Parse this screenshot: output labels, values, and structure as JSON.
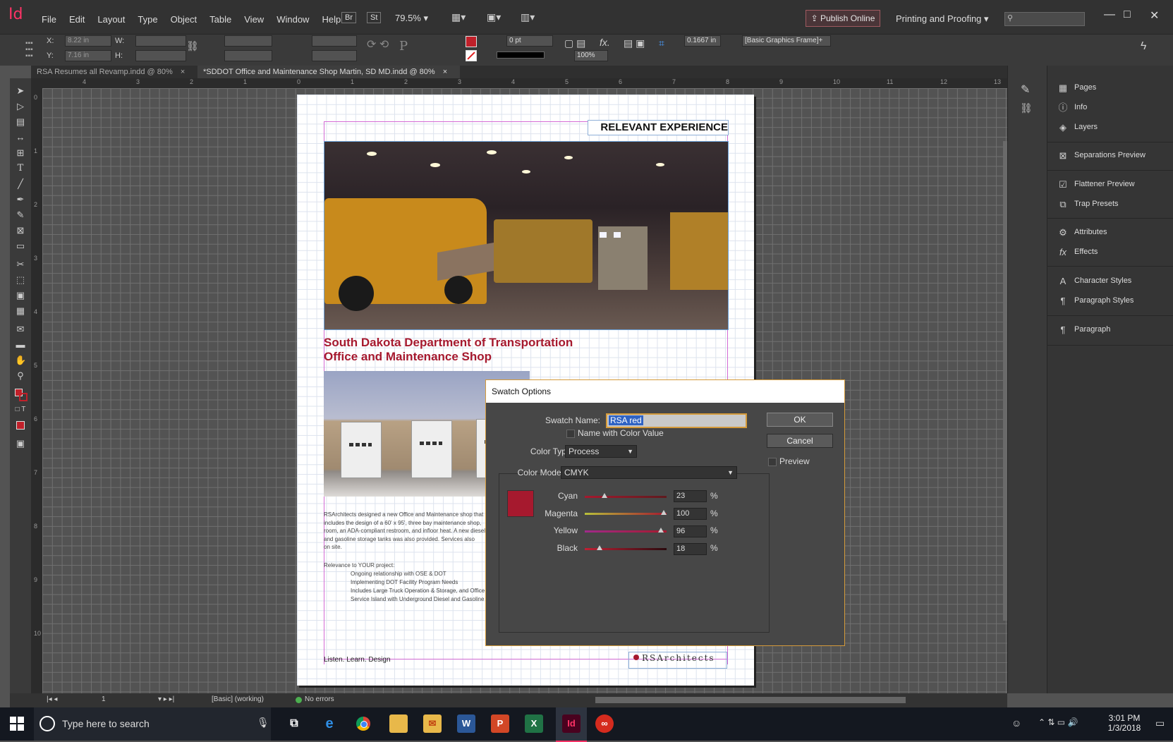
{
  "app": {
    "logo": "Id"
  },
  "menu": [
    "File",
    "Edit",
    "Layout",
    "Type",
    "Object",
    "Table",
    "View",
    "Window",
    "Help"
  ],
  "top_toolbar": {
    "br": "Br",
    "st": "St",
    "zoom": "79.5%",
    "publish_label": "Publish Online",
    "workspace": "Printing and Proofing"
  },
  "window_controls": {
    "minimize": "—",
    "maximize": "□",
    "close": "✕"
  },
  "control_bar": {
    "x_label": "X:",
    "x_value": "8.22 in",
    "y_label": "Y:",
    "y_value": "7.16 in",
    "w_label": "W:",
    "h_label": "H:",
    "stroke_weight": "0 pt",
    "opacity": "100%",
    "offset": "0.1667 in",
    "object_style": "[Basic Graphics Frame]+"
  },
  "tabs": [
    {
      "label": "RSA Resumes all Revamp.indd @ 80%",
      "close": "×"
    },
    {
      "label": "*SDDOT Office and Maintenance Shop Martin, SD MD.indd @ 80%",
      "close": "×"
    }
  ],
  "ruler_h": [
    "4",
    "3",
    "2",
    "1",
    "0",
    "1",
    "2",
    "3",
    "4",
    "5",
    "6",
    "7",
    "8",
    "9",
    "10",
    "11",
    "12",
    "13"
  ],
  "ruler_v": [
    "0",
    "1",
    "2",
    "3",
    "4",
    "5",
    "6",
    "7",
    "8",
    "9",
    "10"
  ],
  "document": {
    "heading": "RELEVANT EXPERIENCE",
    "project_title_1": "South Dakota Department of Transportation",
    "project_title_2": "Office and Maintenance Shop",
    "body_1": "RSArchitects designed a new Office and Maintenance shop that",
    "body_2": "includes the design of a 60' x 95', three bay maintenance shop,",
    "body_3": "room, an ADA-compliant restroom, and infloor heat.  A new diesel",
    "body_4": "and gasoline storage tanks was also provided. Services also",
    "body_5": "on site.",
    "relevance_title": "Relevance to YOUR project:",
    "relevance_items": [
      "Ongoing relationship with OSE & DOT",
      "Implementing DOT Facility Program Needs",
      "Includes Large Truck Operation & Storage, and Office",
      "Service Island with Underground Diesel and Gasoline"
    ],
    "footer_tagline": "Listen. Learn. Design",
    "footer_logo": "RSArchitects"
  },
  "panels": [
    {
      "label": "Pages",
      "icon": "pages-icon"
    },
    {
      "label": "Info",
      "icon": "info-icon"
    },
    {
      "label": "Layers",
      "icon": "layers-icon"
    },
    {
      "label": "Separations Preview",
      "icon": "separations-icon"
    },
    {
      "label": "Flattener Preview",
      "icon": "flattener-icon"
    },
    {
      "label": "Trap Presets",
      "icon": "trap-icon"
    },
    {
      "label": "Attributes",
      "icon": "attributes-icon"
    },
    {
      "label": "Effects",
      "icon": "effects-icon"
    },
    {
      "label": "Character Styles",
      "icon": "character-styles-icon"
    },
    {
      "label": "Paragraph Styles",
      "icon": "paragraph-styles-icon"
    },
    {
      "label": "Paragraph",
      "icon": "paragraph-icon"
    }
  ],
  "status_bar": {
    "page": "1",
    "profile": "[Basic] (working)",
    "preflight": "No errors"
  },
  "dialog": {
    "title": "Swatch Options",
    "swatch_name_label": "Swatch Name:",
    "swatch_name_value": "RSA red",
    "name_with_color_value_label": "Name with Color Value",
    "color_type_label": "Color Type:",
    "color_type_value": "Process",
    "color_mode_label": "Color Mode:",
    "color_mode_value": "CMYK",
    "ok_label": "OK",
    "cancel_label": "Cancel",
    "preview_label": "Preview",
    "swatch_color": "#a6192e",
    "channels": [
      {
        "name": "Cyan",
        "value": "23",
        "unit": "%"
      },
      {
        "name": "Magenta",
        "value": "100",
        "unit": "%"
      },
      {
        "name": "Yellow",
        "value": "96",
        "unit": "%"
      },
      {
        "name": "Black",
        "value": "18",
        "unit": "%"
      }
    ]
  },
  "taskbar": {
    "search_placeholder": "Type here to search",
    "time": "3:01 PM",
    "date": "1/3/2018"
  },
  "colors": {
    "accent": "#ff3366",
    "doc_red": "#a6192e",
    "dialog_border": "#d49a3a"
  }
}
